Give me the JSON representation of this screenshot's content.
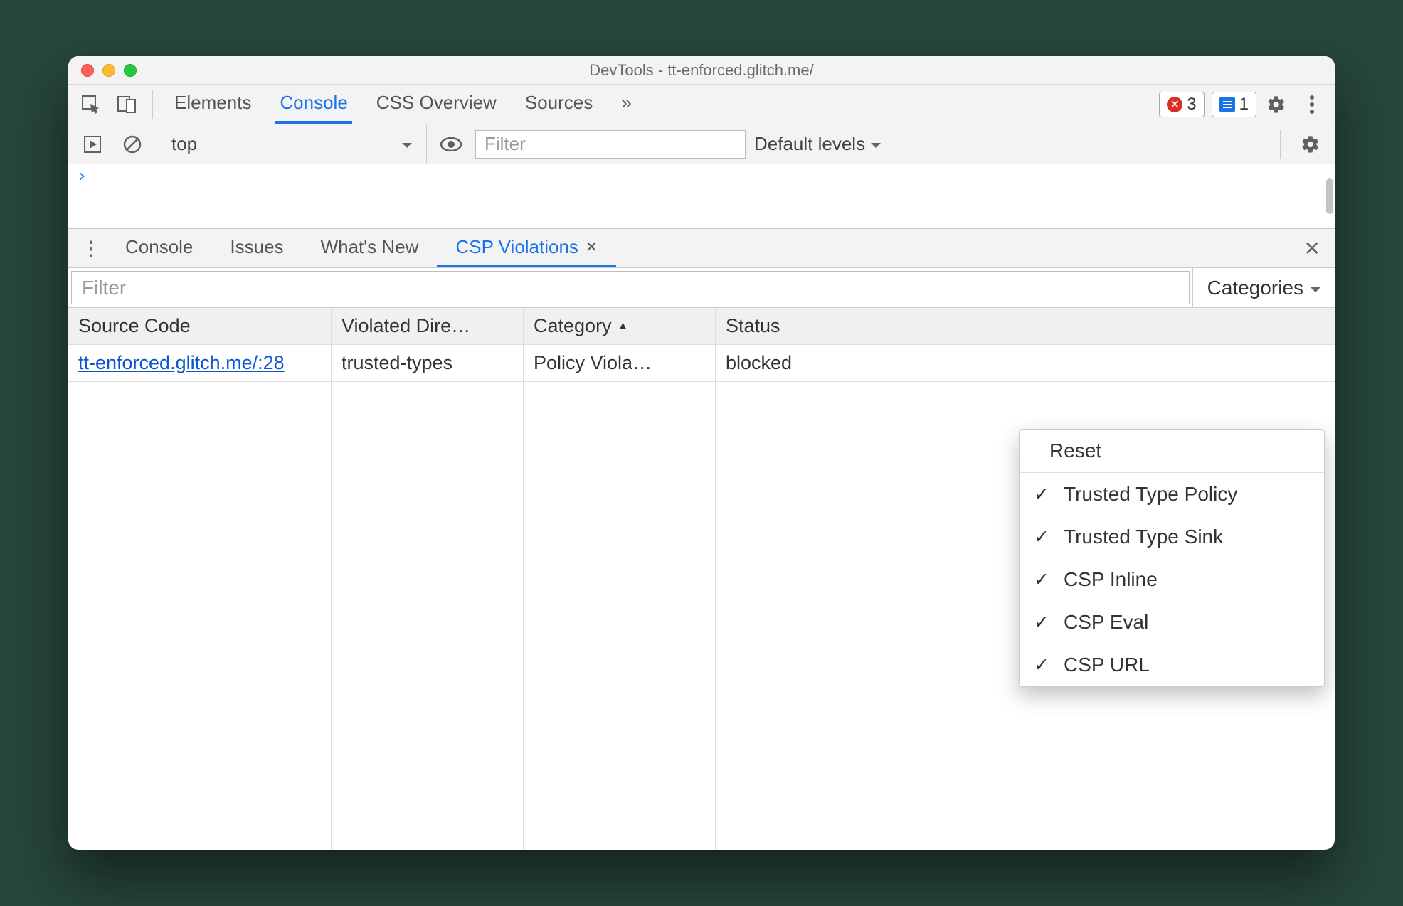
{
  "window": {
    "title": "DevTools - tt-enforced.glitch.me/"
  },
  "toolbar": {
    "tabs": [
      "Elements",
      "Console",
      "CSS Overview",
      "Sources"
    ],
    "more_indicator": "»",
    "error_count": "3",
    "info_count": "1"
  },
  "consoleBar": {
    "context": "top",
    "filter_placeholder": "Filter",
    "levels_label": "Default levels"
  },
  "drawer": {
    "tabs": [
      "Console",
      "Issues",
      "What's New",
      "CSP Violations"
    ],
    "active_index": 3
  },
  "cspPanel": {
    "filter_placeholder": "Filter",
    "categories_label": "Categories",
    "columns": [
      "Source Code",
      "Violated Dire…",
      "Category",
      "Status"
    ],
    "rows": [
      {
        "source": "tt-enforced.glitch.me/:28",
        "directive": "trusted-types",
        "category": "Policy Viola…",
        "status": "blocked"
      }
    ]
  },
  "categoriesMenu": {
    "reset": "Reset",
    "items": [
      "Trusted Type Policy",
      "Trusted Type Sink",
      "CSP Inline",
      "CSP Eval",
      "CSP URL"
    ]
  }
}
